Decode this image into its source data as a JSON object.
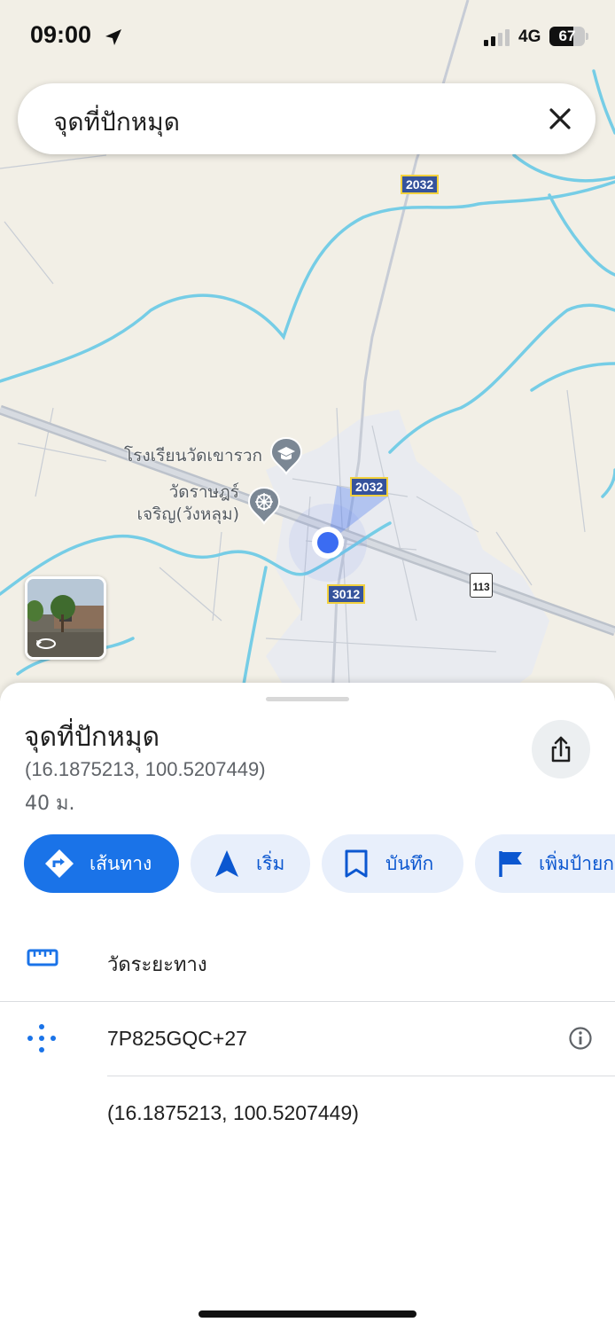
{
  "status_bar": {
    "time": "09:00",
    "network": "4G",
    "battery": "67",
    "battery_level": 0.67
  },
  "search": {
    "query": "จุดที่ปักหมุด"
  },
  "map": {
    "route_shields": [
      "2032",
      "2032",
      "3012"
    ],
    "route_113": "113",
    "pois": [
      {
        "name": "โรงเรียนวัดเขารวก",
        "icon": "school-icon"
      },
      {
        "name_line1": "วัดราษฎร์",
        "name_line2": "เจริญ(วังหลุม)",
        "icon": "temple-icon"
      }
    ]
  },
  "place": {
    "title": "จุดที่ปักหมุด",
    "coordinates": "(16.1875213, 100.5207449)",
    "distance": "40 ม."
  },
  "actions": [
    {
      "label": "เส้นทาง",
      "icon": "directions-icon"
    },
    {
      "label": "เริ่ม",
      "icon": "navigation-arrow-icon"
    },
    {
      "label": "บันทึก",
      "icon": "bookmark-icon"
    },
    {
      "label": "เพิ่มป้ายก",
      "icon": "flag-icon"
    }
  ],
  "details": {
    "measure_label": "วัดระยะทาง",
    "plus_code": "7P825GQC+27",
    "coordinates": "(16.1875213, 100.5207449)"
  },
  "colors": {
    "accent": "#1a73e8",
    "water": "#76cde6",
    "map_bg": "#f2efe6",
    "location_dot": "#3b6cf2"
  }
}
